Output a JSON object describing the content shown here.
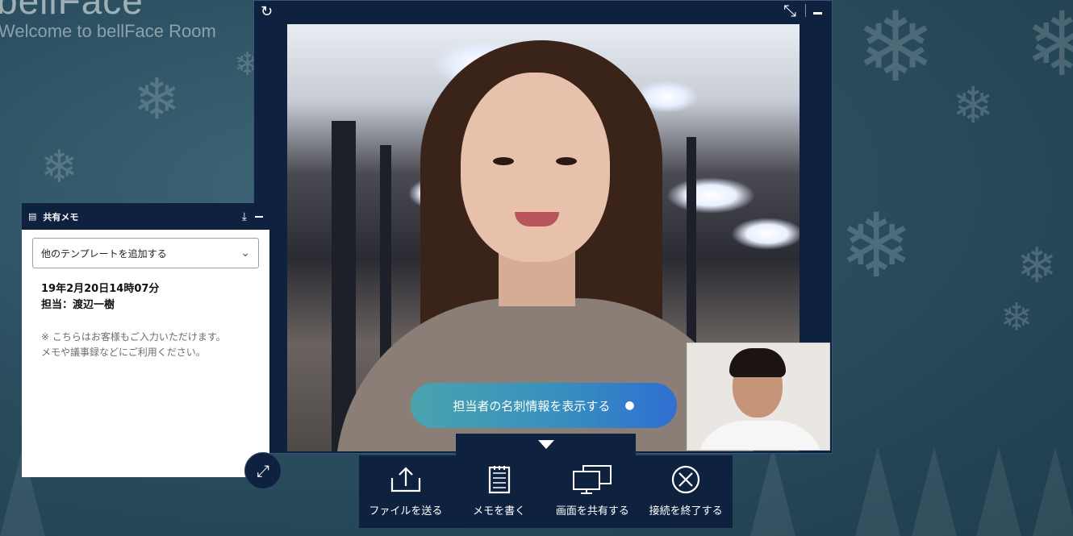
{
  "brand": {
    "logo": "bellFace",
    "welcome": "Welcome to bellFace Room"
  },
  "video_window": {
    "refresh_icon": "refresh-icon",
    "shrink_icon": "shrink-icon",
    "minimize_icon": "minimize-icon",
    "card_button_label": "担当者の名刺情報を表示する",
    "card_button_icon": "user-icon"
  },
  "toolbar": {
    "toggle_icon": "caret-down-icon",
    "items": [
      {
        "label": "ファイルを送る",
        "icon": "upload-icon"
      },
      {
        "label": "メモを書く",
        "icon": "memo-icon"
      },
      {
        "label": "画面を共有する",
        "icon": "screen-share-icon"
      },
      {
        "label": "接続を終了する",
        "icon": "close-circle-icon"
      }
    ]
  },
  "memo": {
    "title": "共有メモ",
    "template_select": "他のテンプレートを追加する",
    "date_line": "19年2月20日14時07分",
    "person_line": "担当：渡辺一樹",
    "note_line1": "※ こちらはお客様もご入力いただけます。",
    "note_line2": "メモや議事録などにご利用ください。"
  },
  "colors": {
    "panel": "#0e2240",
    "background": "#2b4f60",
    "accent_start": "#4aa4ae",
    "accent_end": "#2f6fd1"
  }
}
